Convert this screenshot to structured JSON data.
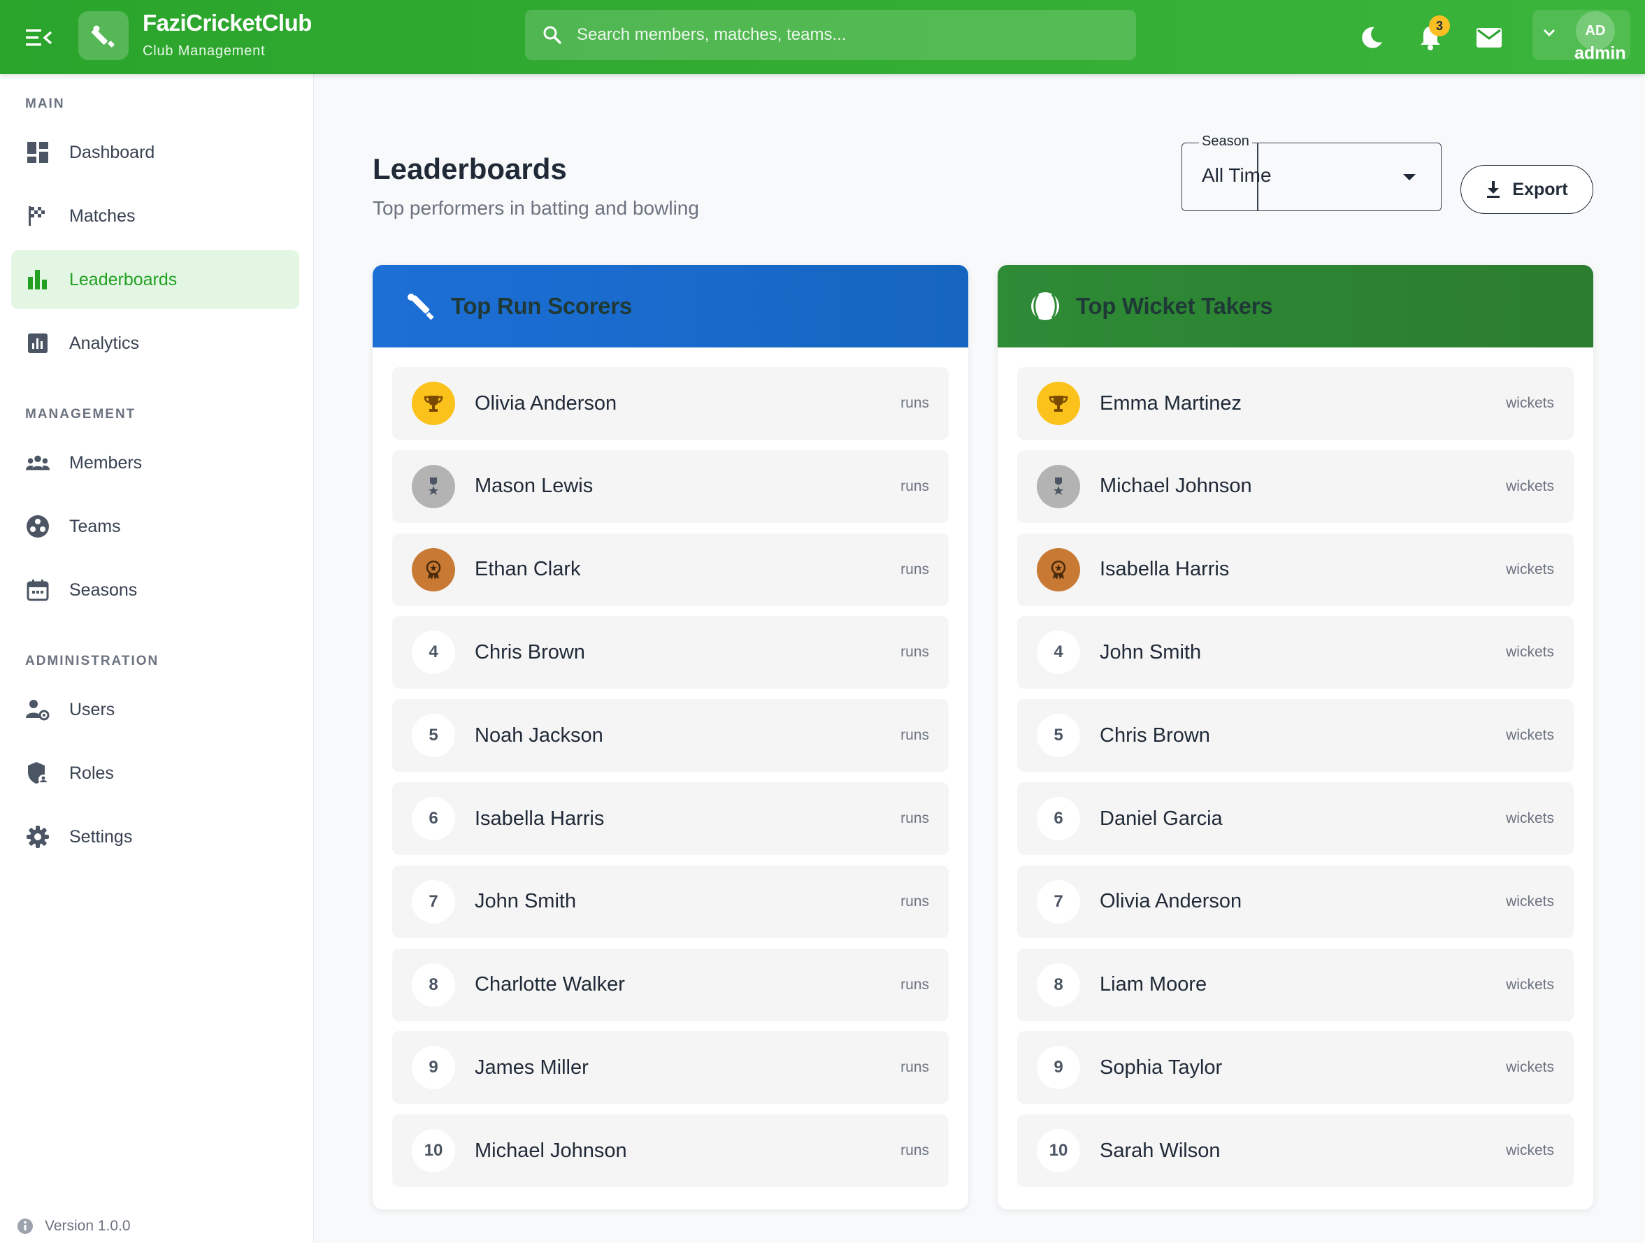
{
  "app": {
    "brand_name": "FaziCricketClub",
    "brand_sub": "Club Management",
    "search_placeholder": "Search members, matches, teams...",
    "notification_count": "3",
    "user_initials": "AD",
    "user_name": "admin"
  },
  "sidebar": {
    "section_main": "MAIN",
    "section_management": "MANAGEMENT",
    "section_administration": "ADMINISTRATION",
    "items": [
      {
        "label": "Dashboard",
        "icon": "dashboard-icon"
      },
      {
        "label": "Matches",
        "icon": "checkered-flag-icon"
      },
      {
        "label": "Leaderboards",
        "icon": "bar-chart-icon",
        "active": true
      },
      {
        "label": "Analytics",
        "icon": "analytics-icon"
      },
      {
        "label": "Members",
        "icon": "group-icon"
      },
      {
        "label": "Teams",
        "icon": "teams-icon"
      },
      {
        "label": "Seasons",
        "icon": "calendar-icon"
      },
      {
        "label": "Users",
        "icon": "user-settings-icon"
      },
      {
        "label": "Roles",
        "icon": "shield-user-icon"
      },
      {
        "label": "Settings",
        "icon": "gear-icon"
      }
    ],
    "version": "Version 1.0.0"
  },
  "page": {
    "title": "Leaderboards",
    "subtitle": "Top performers in batting and bowling",
    "season_label": "Season",
    "season_value": "All Time",
    "export_label": "Export"
  },
  "batting": {
    "title": "Top Run Scorers",
    "unit": "runs",
    "rows": [
      {
        "rank": "1",
        "name": "Olivia Anderson"
      },
      {
        "rank": "2",
        "name": "Mason Lewis"
      },
      {
        "rank": "3",
        "name": "Ethan Clark"
      },
      {
        "rank": "4",
        "name": "Chris Brown"
      },
      {
        "rank": "5",
        "name": "Noah Jackson"
      },
      {
        "rank": "6",
        "name": "Isabella Harris"
      },
      {
        "rank": "7",
        "name": "John Smith"
      },
      {
        "rank": "8",
        "name": "Charlotte Walker"
      },
      {
        "rank": "9",
        "name": "James Miller"
      },
      {
        "rank": "10",
        "name": "Michael Johnson"
      }
    ]
  },
  "bowling": {
    "title": "Top Wicket Takers",
    "unit": "wickets",
    "rows": [
      {
        "rank": "1",
        "name": "Emma Martinez"
      },
      {
        "rank": "2",
        "name": "Michael Johnson"
      },
      {
        "rank": "3",
        "name": "Isabella Harris"
      },
      {
        "rank": "4",
        "name": "John Smith"
      },
      {
        "rank": "5",
        "name": "Chris Brown"
      },
      {
        "rank": "6",
        "name": "Daniel Garcia"
      },
      {
        "rank": "7",
        "name": "Olivia Anderson"
      },
      {
        "rank": "8",
        "name": "Liam Moore"
      },
      {
        "rank": "9",
        "name": "Sophia Taylor"
      },
      {
        "rank": "10",
        "name": "Sarah Wilson"
      }
    ]
  },
  "colors": {
    "topbar": "#2aa42b",
    "accent": "#23a023",
    "batting_header": "#1565c0",
    "bowling_header": "#2e7d32",
    "gold": "#fbc21b",
    "silver": "#b3b3b3",
    "bronze": "#c87a34",
    "badge": "#fbbf24"
  }
}
